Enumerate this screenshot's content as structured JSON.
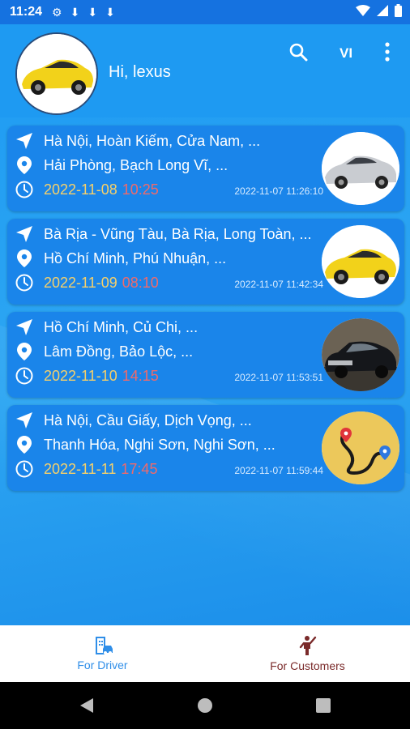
{
  "status": {
    "time": "11:24",
    "icons": [
      "gear-icon",
      "download-icon",
      "download-icon",
      "download-icon"
    ],
    "right_icons": [
      "wifi-icon",
      "signal-icon",
      "battery-icon"
    ]
  },
  "header": {
    "greeting": "Hi, lexus",
    "lang": "VI",
    "avatar_image": "yellow-car"
  },
  "trips": [
    {
      "from": "Hà Nội, Hoàn Kiếm, Cửa Nam, ...",
      "to": "Hải Phòng, Bạch Long Vĩ, ...",
      "date": "2022-11-08",
      "time": "10:25",
      "created": "2022-11-07 11:26:10",
      "image": "silver-sedan"
    },
    {
      "from": "Bà Rịa - Vũng Tàu, Bà Rịa, Long Toàn, ...",
      "to": "Hồ Chí Minh, Phú Nhuận, ...",
      "date": "2022-11-09",
      "time": "08:10",
      "created": "2022-11-07 11:42:34",
      "image": "yellow-car"
    },
    {
      "from": "Hồ Chí Minh, Củ Chi, ...",
      "to": "Lâm Đồng, Bảo Lộc, ...",
      "date": "2022-11-10",
      "time": "14:15",
      "created": "2022-11-07 11:53:51",
      "image": "black-sedan"
    },
    {
      "from": "Hà Nội, Cầu Giấy, Dịch Vọng, ...",
      "to": "Thanh Hóa, Nghi Sơn, Nghi Sơn, ...",
      "date": "2022-11-11",
      "time": "17:45",
      "created": "2022-11-07 11:59:44",
      "image": "route-logo"
    }
  ],
  "nav": {
    "driver_label": "For Driver",
    "customers_label": "For Customers"
  },
  "colors": {
    "primary": "#1e9af2",
    "card": "#1a85ea",
    "date": "#f6d06a",
    "time": "#f06a6a",
    "driver_active": "#2f8ee8",
    "customers": "#7a2a2a"
  }
}
